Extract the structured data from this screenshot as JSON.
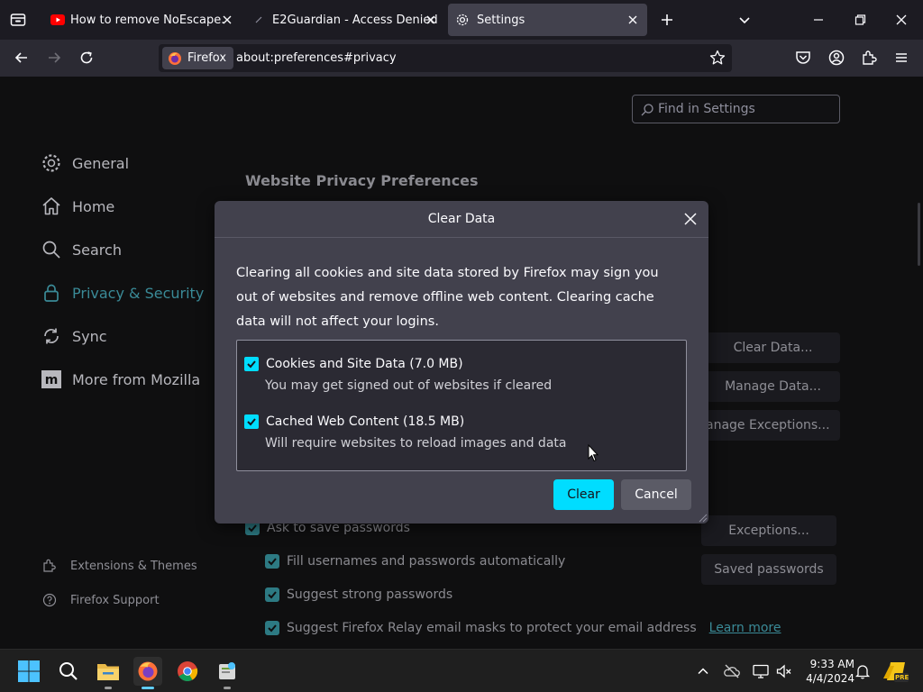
{
  "tabs": [
    {
      "title": "How to remove NoEscape.exe [",
      "icon": "youtube-icon"
    },
    {
      "title": "E2Guardian - Access Denied",
      "icon": "blank-page-icon"
    },
    {
      "title": "Settings",
      "icon": "gear-icon"
    }
  ],
  "nav": {
    "identity_label": "Firefox",
    "url": "about:preferences#privacy"
  },
  "find": {
    "placeholder": "Find in Settings"
  },
  "sidebar": {
    "items": [
      {
        "label": "General",
        "icon": "gear-icon"
      },
      {
        "label": "Home",
        "icon": "home-icon"
      },
      {
        "label": "Search",
        "icon": "search-icon"
      },
      {
        "label": "Privacy & Security",
        "icon": "lock-icon"
      },
      {
        "label": "Sync",
        "icon": "sync-icon"
      },
      {
        "label": "More from Mozilla",
        "icon": "mozilla-icon"
      }
    ],
    "footer": [
      {
        "label": "Extensions & Themes",
        "icon": "puzzle-icon"
      },
      {
        "label": "Firefox Support",
        "icon": "help-icon"
      }
    ]
  },
  "main": {
    "section_title": "Website Privacy Preferences",
    "buttons": {
      "clear_data": "Clear Data...",
      "manage_data": "Manage Data...",
      "manage_exceptions": "anage Exceptions...",
      "exceptions": "Exceptions...",
      "saved_passwords": "Saved passwords"
    },
    "passwords": {
      "ask_save": "Ask to save passwords",
      "fill_auto": "Fill usernames and passwords automatically",
      "suggest_strong": "Suggest strong passwords",
      "suggest_relay": "Suggest Firefox Relay email masks to protect your email address",
      "learn_more": "Learn more"
    }
  },
  "dialog": {
    "title": "Clear Data",
    "description": "Clearing all cookies and site data stored by Firefox may sign you out of websites and remove offline web content. Clearing cache data will not affect your logins.",
    "options": [
      {
        "label": "Cookies and Site Data (7.0 MB)",
        "sub": "You may get signed out of websites if cleared",
        "checked": true
      },
      {
        "label": "Cached Web Content (18.5 MB)",
        "sub": "Will require websites to reload images and data",
        "checked": true
      }
    ],
    "clear_label": "Clear",
    "cancel_label": "Cancel"
  },
  "taskbar": {
    "time": "9:33 AM",
    "date": "4/4/2024",
    "pre_badge": "PRE"
  },
  "colors": {
    "accent": "#00ddff",
    "selected_nav": "#3a8a97",
    "dialog_bg": "#42414d"
  }
}
